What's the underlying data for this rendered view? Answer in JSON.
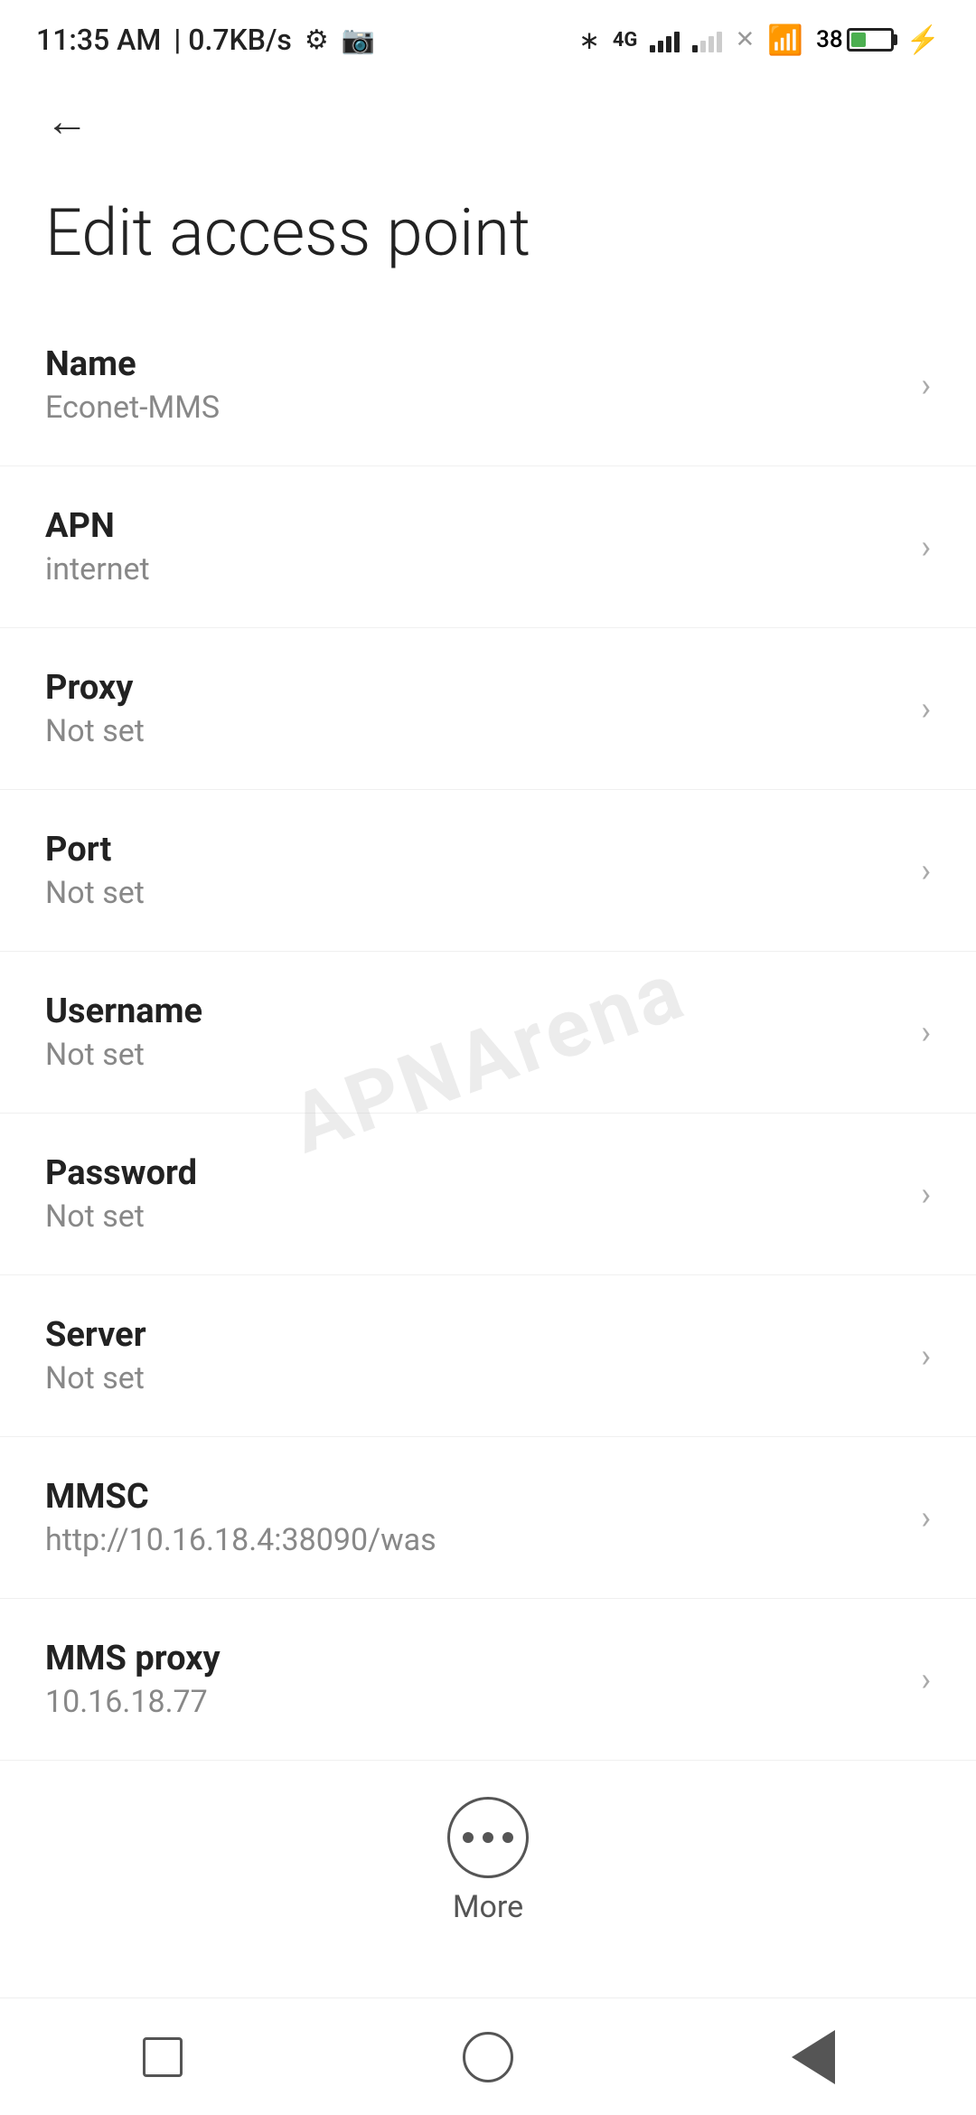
{
  "statusBar": {
    "time": "11:35 AM",
    "speed": "0.7KB/s",
    "batteryPercent": "38"
  },
  "nav": {
    "backLabel": "←"
  },
  "page": {
    "title": "Edit access point"
  },
  "settings": [
    {
      "label": "Name",
      "value": "Econet-MMS"
    },
    {
      "label": "APN",
      "value": "internet"
    },
    {
      "label": "Proxy",
      "value": "Not set"
    },
    {
      "label": "Port",
      "value": "Not set"
    },
    {
      "label": "Username",
      "value": "Not set"
    },
    {
      "label": "Password",
      "value": "Not set"
    },
    {
      "label": "Server",
      "value": "Not set"
    },
    {
      "label": "MMSC",
      "value": "http://10.16.18.4:38090/was"
    },
    {
      "label": "MMS proxy",
      "value": "10.16.18.77"
    }
  ],
  "moreButton": {
    "label": "More"
  },
  "watermark": {
    "text": "APNArena"
  }
}
